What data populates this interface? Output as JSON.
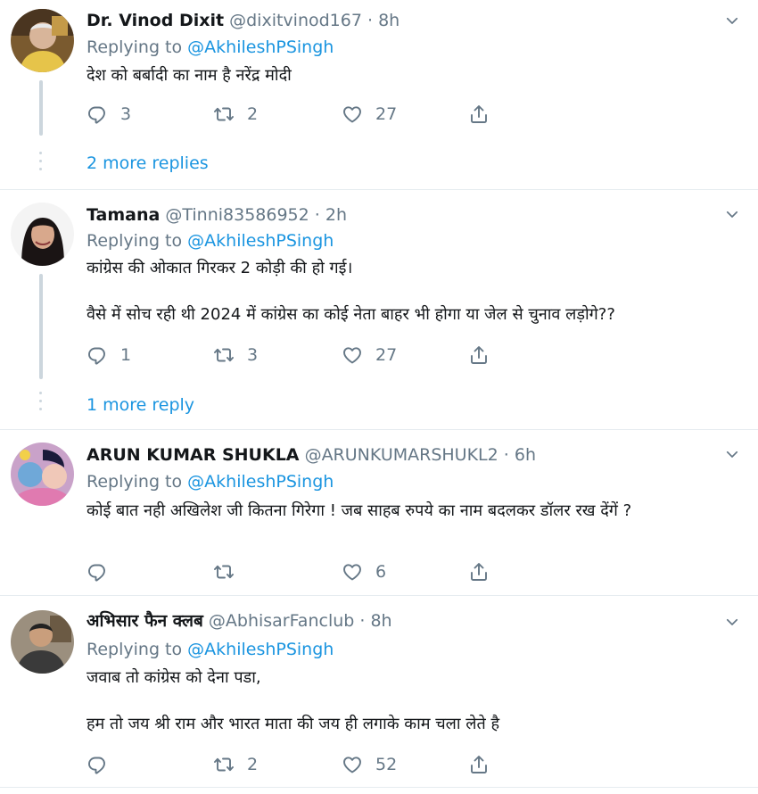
{
  "tweets": [
    {
      "name": "Dr. Vinod Dixit",
      "handle": "@dixitvinod167",
      "time": "8h",
      "replying_prefix": "Replying to ",
      "replying_to": "@AkhileshPSingh",
      "lines": [
        "देश को बर्बादी का नाम है नरेंद्र मोदी"
      ],
      "replies": "3",
      "retweets": "2",
      "likes": "27",
      "more_replies": "2 more replies"
    },
    {
      "name": "Tamana",
      "handle": "@Tinni83586952",
      "time": "2h",
      "replying_prefix": "Replying to ",
      "replying_to": "@AkhileshPSingh",
      "lines": [
        "कांग्रेस की ओकात गिरकर 2 कोड़ी की हो गई।",
        "वैसे में सोच रही थी 2024 में कांग्रेस का कोई नेता बाहर भी होगा या जेल से चुनाव लड़ोगे??"
      ],
      "replies": "1",
      "retweets": "3",
      "likes": "27",
      "more_replies": "1 more reply"
    },
    {
      "name": "ARUN KUMAR SHUKLA",
      "handle": "@ARUNKUMARSHUKL2",
      "time": "6h",
      "replying_prefix": "Replying to ",
      "replying_to": "@AkhileshPSingh",
      "lines": [
        "कोई बात नही अखिलेश जी कितना गिरेगा ! जब साहब रुपये का नाम बदलकर डॉलर रख देंगें ?"
      ],
      "replies": "",
      "retweets": "",
      "likes": "6",
      "more_replies": ""
    },
    {
      "name": "अभिसार फैन क्लब",
      "handle": "@AbhisarFanclub",
      "time": "8h",
      "replying_prefix": "Replying to ",
      "replying_to": "@AkhileshPSingh",
      "lines": [
        "जवाब तो कांग्रेस को देना पडा,",
        "हम तो जय श्री राम और भारत माता की जय ही लगाके काम चला लेते है"
      ],
      "replies": "",
      "retweets": "2",
      "likes": "52",
      "more_replies": ""
    }
  ],
  "colors": {
    "link": "#1b95e0",
    "muted": "#657786",
    "text": "#14171a",
    "divider": "#e6ecf0"
  },
  "icons": {
    "reply": "reply-icon",
    "retweet": "retweet-icon",
    "like": "heart-icon",
    "share": "share-icon",
    "menu": "chevron-down-icon"
  }
}
